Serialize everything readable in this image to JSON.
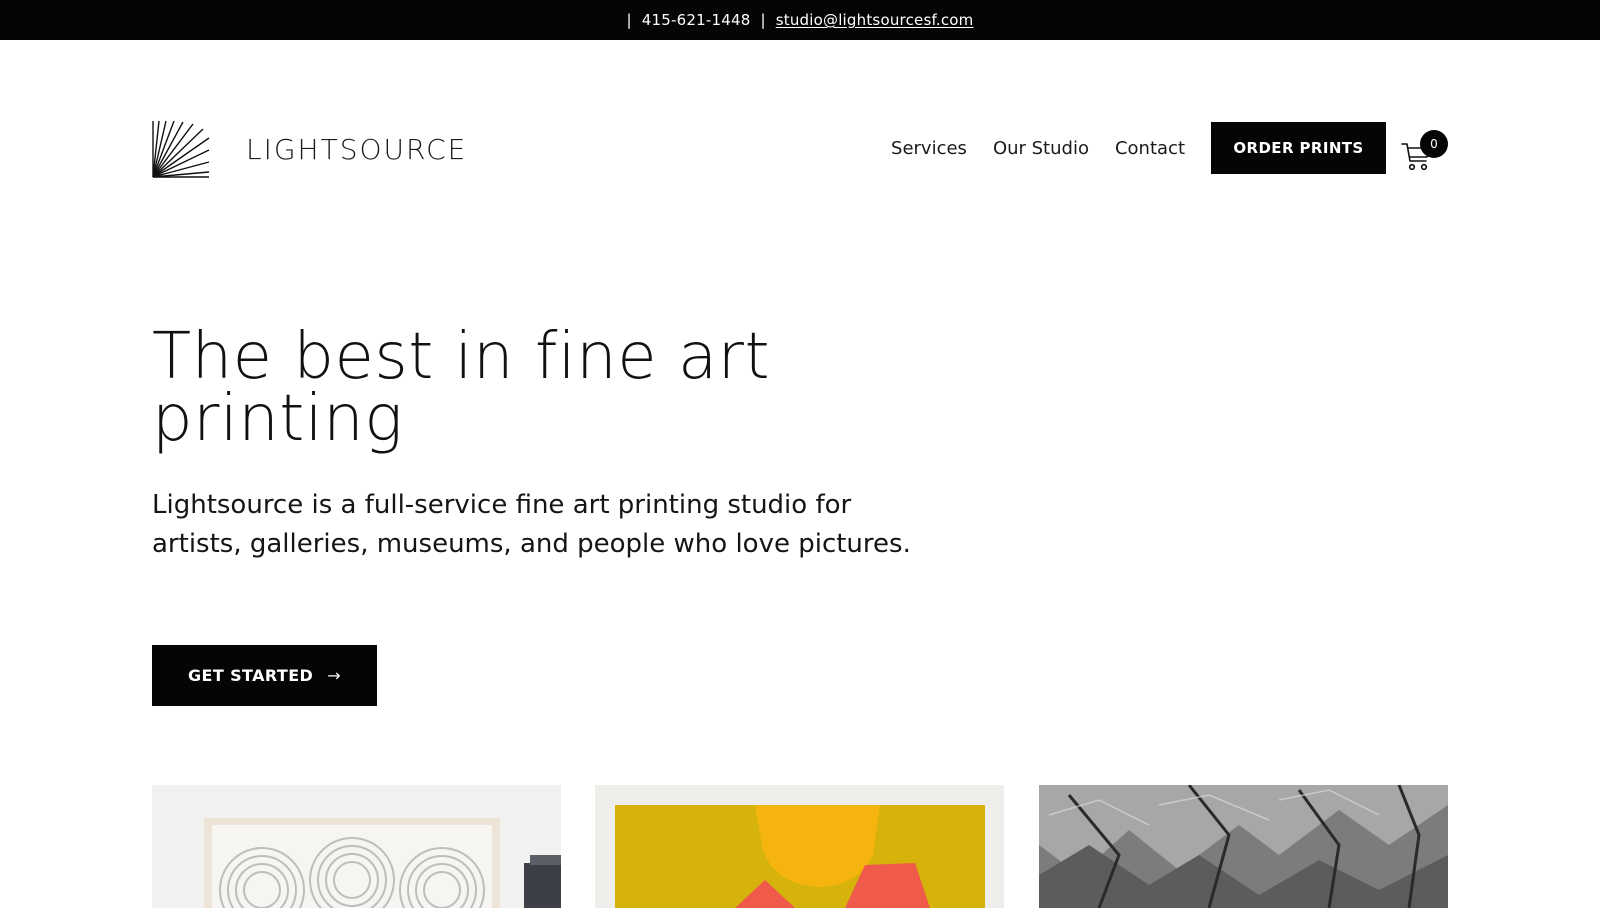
{
  "topbar": {
    "separator": "|",
    "phone": "415-621-1448",
    "email": "studio@lightsourcesf.com"
  },
  "brand": {
    "name": "LIGHTSOURCE",
    "logo_icon": "sunburst-lines-icon"
  },
  "nav": {
    "items": [
      {
        "label": "Services"
      },
      {
        "label": "Our Studio"
      },
      {
        "label": "Contact"
      }
    ],
    "order_button": "ORDER PRINTS",
    "cart": {
      "icon": "cart-icon",
      "count": "0"
    }
  },
  "hero": {
    "title": "The best in fine art printing",
    "description": "Lightsource is a full-service fine art printing studio for artists, galleries, museums, and people who love pictures.",
    "cta_label": "GET STARTED",
    "cta_arrow": "→"
  },
  "gallery": {
    "cards": [
      {
        "alt": "framed-swirl-print-image"
      },
      {
        "alt": "yellow-abstract-print-image"
      },
      {
        "alt": "mountain-landscape-photo-image"
      }
    ]
  },
  "colors": {
    "black": "#050505",
    "white": "#ffffff",
    "text": "#111111"
  }
}
